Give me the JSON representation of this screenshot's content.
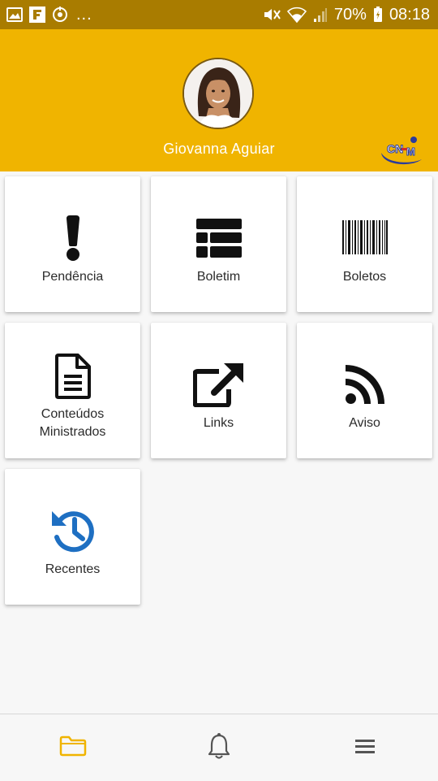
{
  "status_bar": {
    "overflow": "...",
    "battery_percent": "70%",
    "time": "08:18"
  },
  "profile": {
    "name": "Giovanna Aguiar",
    "logo_text": "CNSM"
  },
  "menu": {
    "items": [
      {
        "label": "Pendência",
        "icon": "exclamation-icon"
      },
      {
        "label": "Boletim",
        "icon": "table-list-icon"
      },
      {
        "label": "Boletos",
        "icon": "barcode-icon"
      },
      {
        "label": "Conteúdos",
        "label2": "Ministrados",
        "icon": "document-icon"
      },
      {
        "label": "Links",
        "icon": "external-link-icon"
      },
      {
        "label": "Aviso",
        "icon": "rss-icon"
      },
      {
        "label": "Recentes",
        "icon": "history-icon"
      }
    ]
  },
  "bottom_nav": {
    "items": [
      {
        "icon": "folder-icon",
        "active": true
      },
      {
        "icon": "bell-icon",
        "active": false
      },
      {
        "icon": "menu-icon",
        "active": false
      }
    ]
  },
  "colors": {
    "header": "#f0b400",
    "status_bar": "#a97c00",
    "accent_active": "#f0b400",
    "icon_dark": "#111111",
    "icon_blue": "#1e6fc2"
  }
}
